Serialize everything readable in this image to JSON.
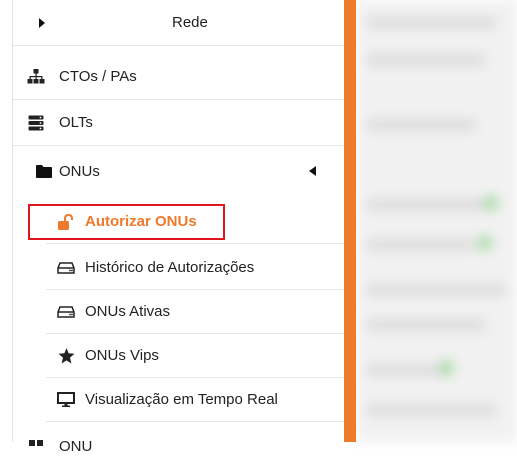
{
  "sidebar": {
    "rede": {
      "label": "Rede"
    },
    "ctos": {
      "label": "CTOs / PAs"
    },
    "olts": {
      "label": "OLTs"
    },
    "onus": {
      "label": "ONUs"
    },
    "sub_items": [
      {
        "label": "Autorizar ONUs",
        "icon": "unlock-icon",
        "color": "#ee7a2b"
      },
      {
        "label": "Histórico de Autorizações",
        "icon": "hdd-icon"
      },
      {
        "label": "ONUs Ativas",
        "icon": "hdd-icon"
      },
      {
        "label": "ONUs Vips",
        "icon": "star-icon"
      },
      {
        "label": "Visualização em Tempo Real",
        "icon": "monitor-icon"
      }
    ],
    "next_partial": {
      "label": "ONU"
    }
  },
  "colors": {
    "accent": "#ee7a2b",
    "highlight_border": "#e0161c"
  }
}
